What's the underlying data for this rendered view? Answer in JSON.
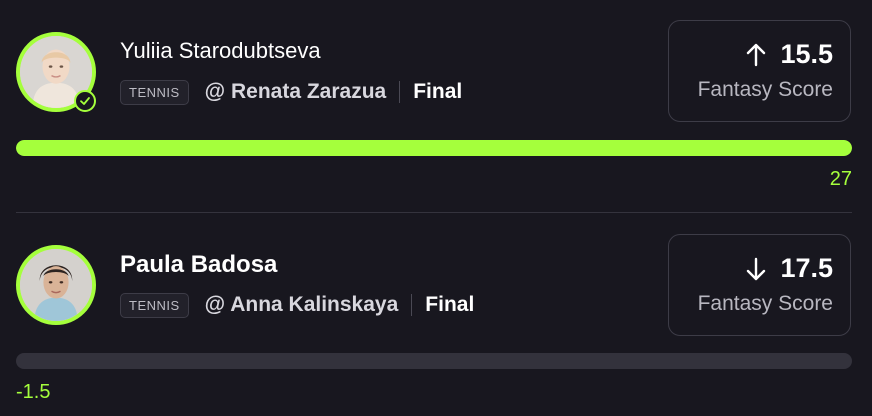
{
  "accent_color": "#a5ff3c",
  "picks": [
    {
      "player_name": "Yuliia Starodubtseva",
      "sport": "TENNIS",
      "opponent": "@ Renata Zarazua",
      "status": "Final",
      "direction": "up",
      "direction_icon": "arrow-up-icon",
      "line": "15.5",
      "stat": "Fantasy Score",
      "progress": 1.0,
      "result": "27",
      "verified": true
    },
    {
      "player_name": "Paula Badosa",
      "sport": "TENNIS",
      "opponent": "@ Anna Kalinskaya",
      "status": "Final",
      "direction": "down",
      "direction_icon": "arrow-down-icon",
      "line": "17.5",
      "stat": "Fantasy Score",
      "progress": 0,
      "result": "-1.5",
      "verified": false
    }
  ]
}
